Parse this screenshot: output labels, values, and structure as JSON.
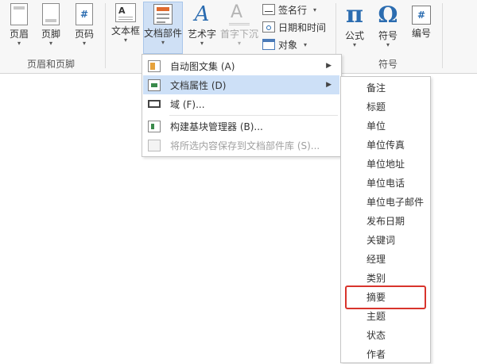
{
  "ribbon": {
    "groups": {
      "header_footer": "页眉和页脚",
      "symbols": "符号"
    },
    "buttons": {
      "header": "页眉",
      "footer": "页脚",
      "page_number": "页码",
      "text_box": "文本框",
      "quick_parts": "文档部件",
      "wordart": "艺术字",
      "drop_cap": "首字下沉",
      "equation": "公式",
      "symbol": "符号",
      "numbering": "编号"
    },
    "small": {
      "signature_line": "签名行",
      "date_time": "日期和时间",
      "object": "对象"
    },
    "glyphs": {
      "wordart": "A",
      "drop_cap": "A",
      "equation": "π",
      "symbol": "Ω",
      "numbering": "#"
    }
  },
  "menu": {
    "items": [
      {
        "label": "自动图文集 (A)",
        "submenu": true
      },
      {
        "label": "文档属性 (D)",
        "submenu": true
      },
      {
        "label": "域 (F)...",
        "submenu": false
      },
      {
        "label": "构建基块管理器 (B)...",
        "submenu": false
      },
      {
        "label": "将所选内容保存到文档部件库 (S)...",
        "submenu": false
      }
    ],
    "arrow": "▶"
  },
  "submenu": {
    "items": [
      "备注",
      "标题",
      "单位",
      "单位传真",
      "单位地址",
      "单位电话",
      "单位电子邮件",
      "发布日期",
      "关键词",
      "经理",
      "类别",
      "摘要",
      "主题",
      "状态",
      "作者"
    ]
  },
  "colors": {
    "accent_blue": "#2b6cb0",
    "highlight": "#cde0f7",
    "red_box": "#d8342c"
  }
}
